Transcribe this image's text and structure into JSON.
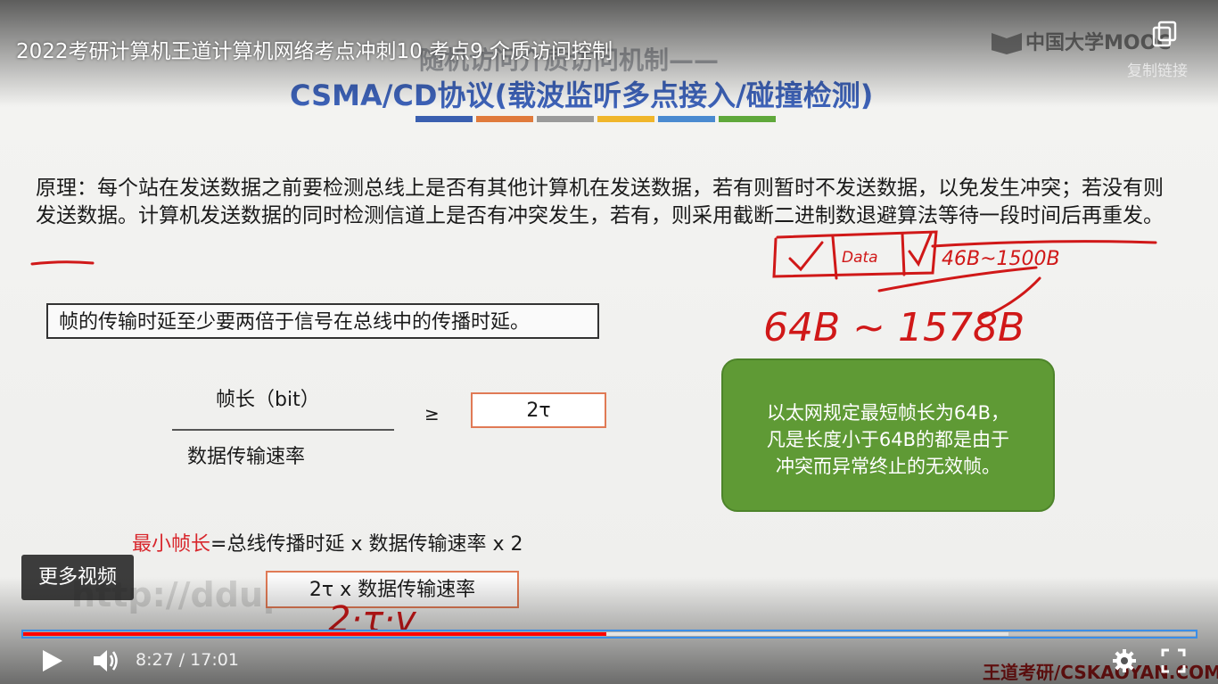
{
  "video": {
    "title": "2022考研计算机王道计算机网络考点冲刺10 考点9 介质访问控制",
    "copy_link_label": "复制链接",
    "logo_text": "中国大学MOOC",
    "more_videos_label": "更多视频",
    "current_time": "8:27",
    "time_separator": " / ",
    "duration": "17:01",
    "progress_fraction": 0.497,
    "buffered_fraction": 0.84
  },
  "slide": {
    "title_line1": "随机访问介质访问机制——",
    "title_line2": "CSMA/CD协议(载波监听多点接入/碰撞检测)",
    "title_bar_colors": [
      "#3a5fb0",
      "#e07a3c",
      "#9a9a9a",
      "#f0b62a",
      "#4a8ad0",
      "#5fa83b"
    ],
    "principle_text": "原理：每个站在发送数据之前要检测总线上是否有其他计算机在发送数据，若有则暂时不发送数据，以免发生冲突；若没有则发送数据。计算机发送数据的同时检测信道上是否有冲突发生，若有，则采用截断二进制数退避算法等待一段时间后再重发。",
    "rule_box_text": "帧的传输时延至少要两倍于信号在总线中的传播时延。",
    "fraction_numerator": "帧长（bit）",
    "fraction_denominator": "数据传输速率",
    "geq_symbol": "≥",
    "tau_box_text": "2τ",
    "green_box_lines": [
      "以太网规定最短帧长为64B，",
      "凡是长度小于64B的都是由于",
      "冲突而异常终止的无效帧。"
    ],
    "formula_highlight": "最小帧长",
    "formula_rest": "=总线传播时延 x 数据传输速率 x 2",
    "formula_box_text": "2τ  x   数据传输速率",
    "watermark_url": "http://ddup.la",
    "brand_bottom": "王道考研/CSKAOYAN.COM",
    "handwriting": {
      "frame_label": "Data",
      "range_top": "46B~1500B",
      "range_bottom": "64B ~ 1578B",
      "bottom_formula": "2·τ·v"
    },
    "accent_green": "#5f9a35",
    "accent_red": "#d8262c",
    "accent_blue": "#3d62b8"
  }
}
